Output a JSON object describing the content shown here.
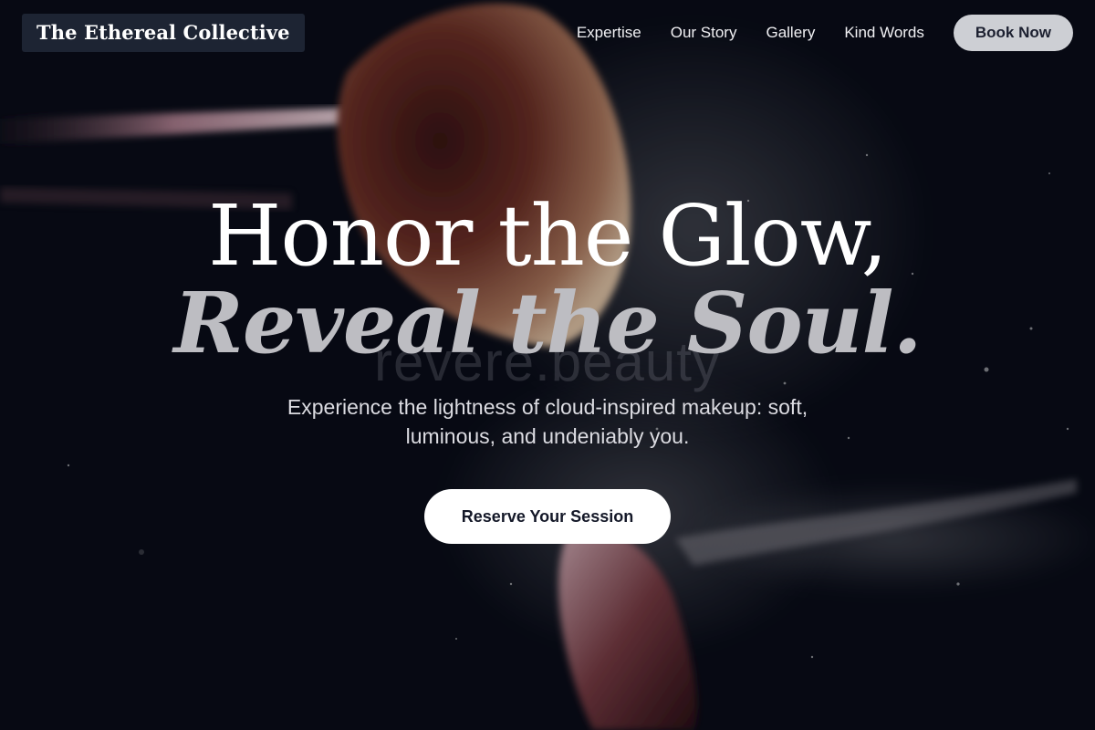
{
  "brand": {
    "name": "The Ethereal Collective"
  },
  "nav": {
    "links": [
      "Expertise",
      "Our Story",
      "Gallery",
      "Kind Words"
    ],
    "cta_label": "Book Now"
  },
  "hero": {
    "headline_line1": "Honor the Glow,",
    "headline_line2": "Reveal the Soul.",
    "watermark": "revere.beauty",
    "subtext": "Experience the lightness of cloud-inspired makeup: soft, luminous, and undeniably you.",
    "cta_label": "Reserve Your Session",
    "background_image": "makeup-brush-powder-photo"
  },
  "colors": {
    "background": "#080a14",
    "brand_box": "#1d2433",
    "nav_button": "#cdcfd4",
    "headline_accent": "#bdbdc2",
    "cta_bg": "#ffffff"
  }
}
